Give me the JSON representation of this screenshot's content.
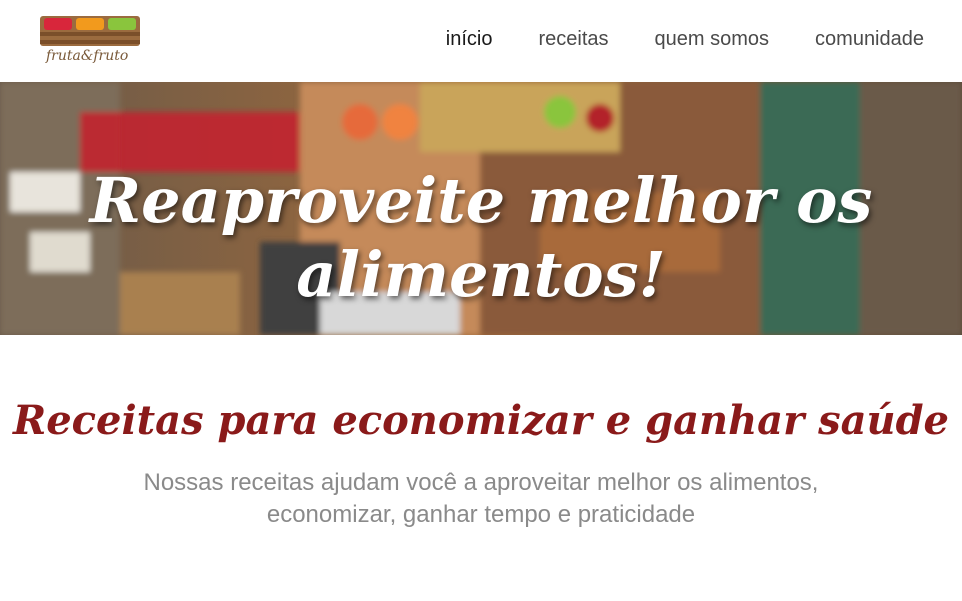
{
  "header": {
    "logo_text": "fruta&fruto",
    "nav": [
      {
        "label": "início",
        "active": true
      },
      {
        "label": "receitas",
        "active": false
      },
      {
        "label": "quem somos",
        "active": false
      },
      {
        "label": "comunidade",
        "active": false
      }
    ]
  },
  "hero": {
    "title": "Reaproveite melhor os alimentos!"
  },
  "main": {
    "title": "Receitas para economizar e ganhar saúde",
    "text": "Nossas receitas ajudam você a aproveitar melhor os alimentos, economizar, ganhar tempo e praticidade"
  },
  "colors": {
    "title_red": "#8a1a1a",
    "text_gray": "#8a8a8a"
  }
}
